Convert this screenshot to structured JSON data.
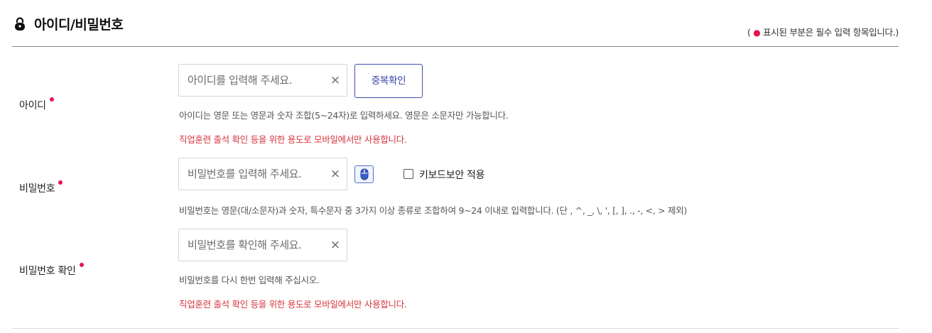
{
  "section": {
    "title": "아이디/비밀번호",
    "required_note_open": "( ",
    "required_note_dot": "●",
    "required_note_text": " 표시된 부분은 필수 입력 항목입니다.)"
  },
  "id_row": {
    "label": "아이디",
    "input_value": "",
    "input_placeholder": "아이디를 입력해 주세요.",
    "clear_symbol": "×",
    "check_button_label": "중복확인",
    "help_text": "아이디는 영문 또는 영문과 숫자 조합(5~24자)로 입력하세요. 영문은 소문자만 가능합니다.",
    "warning_text": "직업훈련 출석 확인 등을 위한 용도로 모바일에서만 사용합니다."
  },
  "password_row": {
    "label": "비밀번호",
    "input_value": "",
    "input_placeholder": "비밀번호를 입력해 주세요.",
    "clear_symbol": "×",
    "mouse_icon": "mouse-icon",
    "keyboard_security_label": "키보드보안 적용",
    "keyboard_security_checked": false,
    "help_text": "비밀번호는 영문(대/소문자)과 숫자, 특수문자 중 3가지 이상 종류로 조합하여 9~24 이내로 입력합니다. (단 , ^, _, \\, ', [, ], ., -, <, > 제외)"
  },
  "confirm_row": {
    "label": "비밀번호 확인",
    "input_value": "",
    "input_placeholder": "비밀번호를 확인해 주세요.",
    "clear_symbol": "×",
    "help_text": "비밀번호를 다시 한번 입력해 주십시오.",
    "warning_text": "직업훈련 출석 확인 등을 위한 용도로 모바일에서만 사용합니다."
  },
  "colors": {
    "accent": "#3f4fb0",
    "required": "#e3174f",
    "warning": "#d6353e"
  }
}
